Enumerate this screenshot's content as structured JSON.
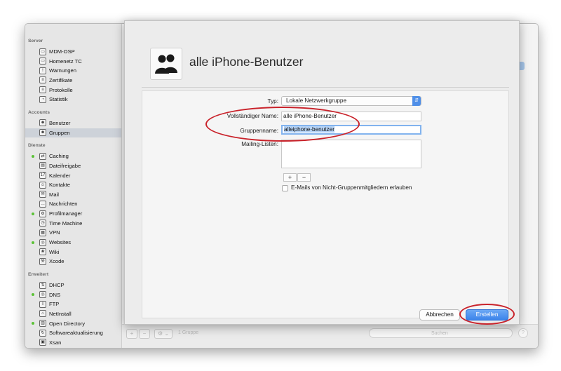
{
  "window": {
    "traffic_colors": [
      "#fd5f57",
      "#febc2e",
      "#28c840"
    ]
  },
  "sidebar": {
    "sections": [
      {
        "title": "Server",
        "items": [
          {
            "label": "MDM-OSP",
            "icon": "server-icon"
          },
          {
            "label": "Homenetz TC",
            "icon": "time-capsule-icon"
          },
          {
            "label": "Warnungen",
            "icon": "alert-icon"
          },
          {
            "label": "Zertifikate",
            "icon": "certificate-icon"
          },
          {
            "label": "Protokolle",
            "icon": "log-icon"
          },
          {
            "label": "Statistik",
            "icon": "stats-icon"
          }
        ]
      },
      {
        "title": "Accounts",
        "items": [
          {
            "label": "Benutzer",
            "icon": "user-icon"
          },
          {
            "label": "Gruppen",
            "icon": "group-icon",
            "selected": true
          }
        ]
      },
      {
        "title": "Dienste",
        "items": [
          {
            "label": "Caching",
            "icon": "caching-icon",
            "active": true
          },
          {
            "label": "Dateifreigabe",
            "icon": "file-sharing-icon"
          },
          {
            "label": "Kalender",
            "icon": "calendar-icon"
          },
          {
            "label": "Kontakte",
            "icon": "contacts-icon"
          },
          {
            "label": "Mail",
            "icon": "mail-icon"
          },
          {
            "label": "Nachrichten",
            "icon": "messages-icon"
          },
          {
            "label": "Profilmanager",
            "icon": "profile-manager-icon",
            "active": true
          },
          {
            "label": "Time Machine",
            "icon": "time-machine-icon"
          },
          {
            "label": "VPN",
            "icon": "vpn-icon"
          },
          {
            "label": "Websites",
            "icon": "websites-icon",
            "active": true
          },
          {
            "label": "Wiki",
            "icon": "wiki-icon"
          },
          {
            "label": "Xcode",
            "icon": "xcode-icon"
          }
        ]
      },
      {
        "title": "Erweitert",
        "items": [
          {
            "label": "DHCP",
            "icon": "dhcp-icon"
          },
          {
            "label": "DNS",
            "icon": "dns-icon",
            "active": true
          },
          {
            "label": "FTP",
            "icon": "ftp-icon"
          },
          {
            "label": "NetInstall",
            "icon": "netinstall-icon"
          },
          {
            "label": "Open Directory",
            "icon": "open-directory-icon",
            "active": true
          },
          {
            "label": "Softwareaktualisierung",
            "icon": "software-update-icon"
          },
          {
            "label": "Xsan",
            "icon": "xsan-icon"
          }
        ]
      }
    ],
    "active_dot_color": "#5bc236"
  },
  "bottombar": {
    "add_label": "+",
    "remove_label": "−",
    "gear_label": "⚙ ⌄",
    "count_label": "1 Gruppe",
    "search_placeholder": "Suchen",
    "help_label": "?"
  },
  "sheet": {
    "title": "alle iPhone-Benutzer",
    "type_label": "Typ:",
    "type_value": "Lokale Netzwerkgruppe",
    "fullname_label": "Vollständiger Name:",
    "fullname_value": "alle iPhone-Benutzer",
    "groupname_label": "Gruppenname:",
    "groupname_value": "alleiphone-benutzer",
    "mailing_label": "Mailing-Listen:",
    "add_label": "+",
    "remove_label": "−",
    "checkbox_label": "E-Mails von Nicht-Gruppenmitgliedern erlauben",
    "checkbox_checked": false,
    "cancel_label": "Abbrechen",
    "create_label": "Erstellen"
  },
  "colors": {
    "accent": "#3c84ea",
    "highlight": "#c9222a"
  }
}
